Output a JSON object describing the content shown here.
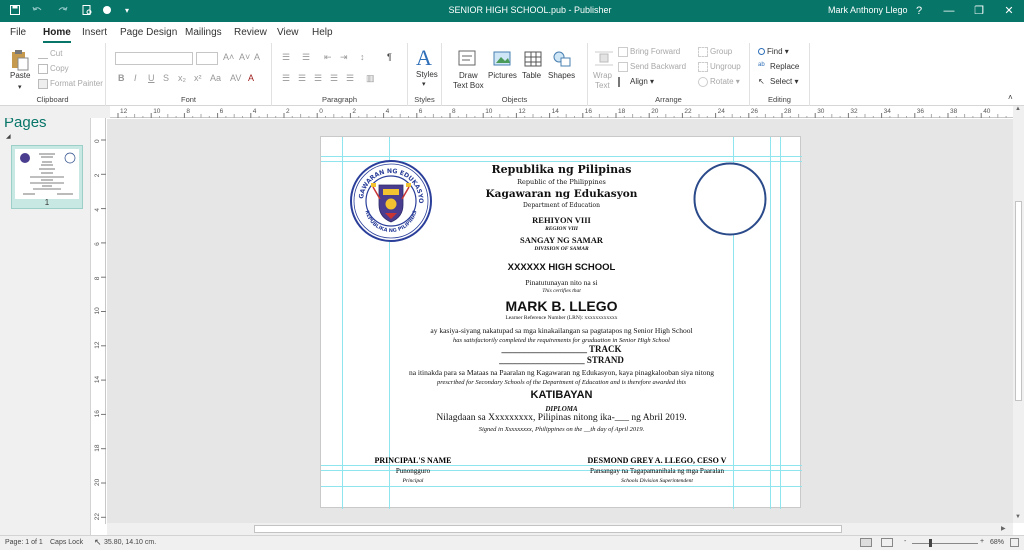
{
  "titlebar": {
    "doc_title": "SENIOR HIGH SCHOOL.pub  -  Publisher",
    "user": "Mark Anthony Llego",
    "help": "?",
    "colors": {
      "brand": "#077568"
    }
  },
  "tabs": [
    "File",
    "Home",
    "Insert",
    "Page Design",
    "Mailings",
    "Review",
    "View",
    "Help"
  ],
  "ribbon": {
    "clipboard": {
      "paste": "Paste",
      "cut": "Cut",
      "copy": "Copy",
      "format_painter": "Format Painter",
      "label": "Clipboard"
    },
    "font": {
      "bold": "B",
      "italic": "I",
      "underline": "U",
      "label": "Font"
    },
    "paragraph": {
      "label": "Paragraph",
      "mark": "¶"
    },
    "styles": {
      "styles": "Styles",
      "label": "Styles"
    },
    "objects": {
      "draw_text_box_1": "Draw",
      "draw_text_box_2": "Text Box",
      "pictures": "Pictures",
      "table": "Table",
      "shapes": "Shapes",
      "label": "Objects"
    },
    "arrange": {
      "wrap_1": "Wrap",
      "wrap_2": "Text",
      "bring_forward": "Bring Forward",
      "send_backward": "Send Backward",
      "align": "Align",
      "group": "Group",
      "ungroup": "Ungroup",
      "rotate": "Rotate",
      "label": "Arrange"
    },
    "editing": {
      "find": "Find",
      "replace": "Replace",
      "select": "Select",
      "label": "Editing"
    }
  },
  "pages_panel": {
    "title": "Pages",
    "page_number": "1"
  },
  "rulers": {
    "h_ticks": [
      "12",
      "10",
      "8",
      "6",
      "4",
      "2",
      "0",
      "2",
      "4",
      "6",
      "8",
      "10",
      "12",
      "14",
      "16",
      "18",
      "20",
      "22",
      "24",
      "26",
      "28",
      "30",
      "32",
      "34",
      "36",
      "38",
      "40"
    ],
    "v_ticks": [
      "0",
      "2",
      "4",
      "6",
      "8",
      "10",
      "12",
      "14",
      "16",
      "18",
      "20",
      "22"
    ]
  },
  "document": {
    "republika": "Republika ng Pilipinas",
    "republic": "Republic of the Philippines",
    "kagawaran": "Kagawaran ng Edukasyon",
    "department": "Department of Education",
    "rehiyon": "REHIYON VIII",
    "region": "REGION VIII",
    "sangay": "SANGAY NG SAMAR",
    "division": "DIVISION OF SAMAR",
    "school": "XXXXXX HIGH SCHOOL",
    "pinatutunayan": "Pinatutunayan nito na si",
    "certifies": "This certifies that",
    "student": "MARK B. LLEGO",
    "lrn": "Learner Reference Number (LRN):      xxxxxxxxxxxx",
    "kasiya": "ay kasiya-siyang nakatupad sa mga kinakailangan sa pagtatapos ng Senior High School",
    "satisfactorily": "has satisfactorily completed the requirements for graduation in Senior High School",
    "track_line": "___________________ TRACK",
    "strand_line": "___________________ STRAND",
    "itinakda": "na itinakda para sa Mataas na Paaralan ng Kagawaran ng Edukasyon, kaya pinagkalooban siya nitong",
    "prescribed": "prescribed for Secondary Schools of the Department of Education and is therefore awarded this",
    "katibayan": "KATIBAYAN",
    "diploma": "DIPLOMA",
    "nilagdaan": "Nilagdaan sa Xxxxxxxxx, Pilipinas nitong ika-___ ng Abril 2019.",
    "signed": "Signed in Xxxxxxxxx, Philippines on the __th day of April 2019.",
    "principal_name": "PRINCIPAL'S NAME",
    "punongguro": "Punongguro",
    "principal": "Principal",
    "sds_name": "DESMOND GREY A. LLEGO, CESO V",
    "pansangay": "Pansangay na Tagapamanihala ng mga Paaralan",
    "sds": "Schools Division Superintendent",
    "seal_text_top": "KAGAWARAN NG EDUKASYON",
    "seal_text_bottom": "REPUBLIKA NG PILIPINAS"
  },
  "status": {
    "page": "Page: 1 of 1",
    "caps": "Caps Lock",
    "position": "35.80, 14.10 cm.",
    "zoom": "68%",
    "minus": "-",
    "plus": "+"
  }
}
